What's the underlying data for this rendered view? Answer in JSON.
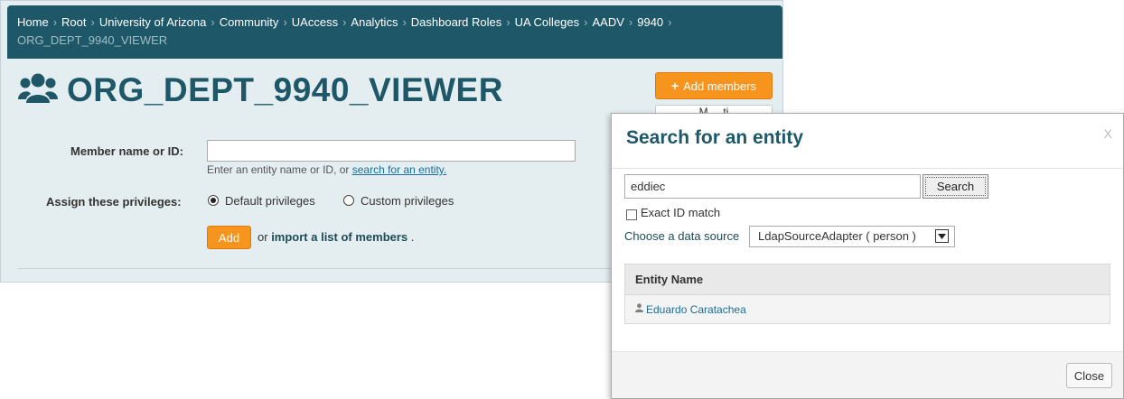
{
  "breadcrumb": {
    "items": [
      "Home",
      "Root",
      "University of Arizona",
      "Community",
      "UAccess",
      "Analytics",
      "Dashboard Roles",
      "UA Colleges",
      "AADV",
      "9940"
    ],
    "current": "ORG_DEPT_9940_VIEWER"
  },
  "page": {
    "title": "ORG_DEPT_9940_VIEWER",
    "icon": "users-icon",
    "add_members_label": "Add members",
    "partial_button_label": "M   ...  ti"
  },
  "form": {
    "member_label": "Member name or ID:",
    "member_value": "",
    "help_prefix": "Enter an entity name or ID, or ",
    "help_link": "search for an entity.",
    "privileges_label": "Assign these privileges:",
    "default_privileges": "Default privileges",
    "custom_privileges": "Custom privileges",
    "selected_privilege": "Default privileges",
    "add_label": "Add",
    "or_text": "or",
    "import_link": "import a list of members",
    "import_suffix": "."
  },
  "modal": {
    "title": "Search for an entity",
    "close_x": "X",
    "search_value": "eddiec",
    "search_button": "Search",
    "exact_match_label": "Exact ID match",
    "exact_match_checked": false,
    "source_label": "Choose a data source",
    "source_value": "LdapSourceAdapter ( person )",
    "table": {
      "header": "Entity Name",
      "rows": [
        {
          "name": "Eduardo Caratachea",
          "icon": "person-icon"
        }
      ]
    },
    "close_button": "Close"
  },
  "colors": {
    "brand_dark": "#1e5868",
    "accent_orange": "#f7941d",
    "panel_bg": "#e4eef1",
    "link": "#1a6f96"
  }
}
